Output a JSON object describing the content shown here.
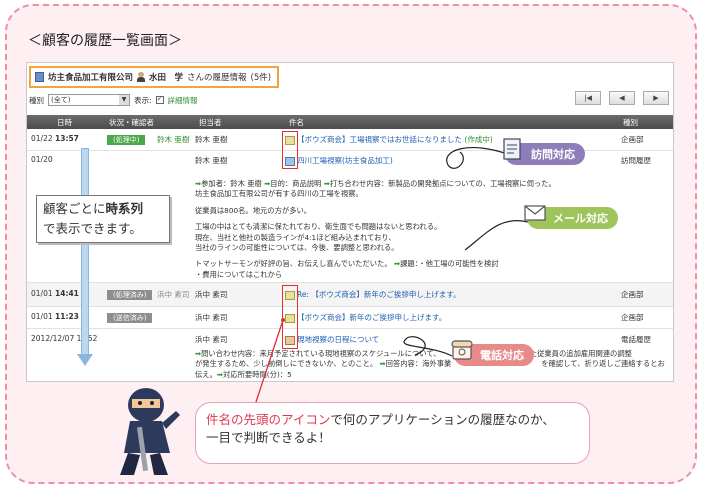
{
  "page_heading": "＜顧客の履歴一覧画面＞",
  "header": {
    "company": "坊主食品加工有限公司",
    "person": "水田　学",
    "suffix": "さんの履歴情報",
    "count": "(5件)"
  },
  "filter": {
    "type_label": "種別",
    "type_value": "(全て)",
    "display_label": "表示:",
    "detail_label": "詳細情報"
  },
  "pager": [
    "|◀",
    "◀",
    "▶"
  ],
  "columns": [
    "日時",
    "状況・確認者",
    "担当者",
    "件名",
    "種別"
  ],
  "rows": [
    {
      "date": "01/22",
      "time": "13:57",
      "status": "(処理中)",
      "confirmer": "鈴木 亜樹",
      "owner": "鈴木 亜樹",
      "subject": "【ボウズ商会】工場視察ではお世話になりました",
      "subject_extra": "(作成中)",
      "kind": "企画部"
    },
    {
      "date": "01/20",
      "time": "",
      "status": "",
      "confirmer": "",
      "owner": "鈴木 亜樹",
      "subject": "四川工場視察",
      "subject_extra": "(坊主食品加工)",
      "kind": "訪問履歴"
    },
    {
      "date": "01/01",
      "time": "14:41",
      "status": "(処理済み)",
      "confirmer": "浜中 素司",
      "owner": "浜中 素司",
      "subject_prefix": "Re:",
      "subject": "【ボウズ商会】新年のご挨拶申し上げます。",
      "subject_extra": "",
      "kind": "企画部"
    },
    {
      "date": "01/01",
      "time": "11:23",
      "status": "(送信済み)",
      "confirmer": "",
      "owner": "浜中 素司",
      "subject": "【ボウズ商会】新年のご挨拶申し上げます。",
      "subject_extra": "",
      "kind": "企画部"
    },
    {
      "date": "2012/12/07",
      "time": "1?:52",
      "status": "",
      "confirmer": "",
      "owner": "浜中 素司",
      "subject": "現地視察の日程について",
      "subject_extra": "",
      "kind": "電話履歴"
    }
  ],
  "visit_detail": [
    "参加者：鈴木 亜樹",
    "目的：商品説明",
    "打ち合わせ内容：新製品の開発拠点についての、工場視察に伺った。",
    "坊主食品加工有限公司が有する四川の工場を視察。",
    "従業員は800名。地元の方が多い。",
    "工場の中はとても清潔に保たれており、衛生面でも問題はないと思われる。",
    "現在、当社と他社の製造ラインが4:1ほど組み込まれており、",
    "当社のラインの可能性については、今後、要調整と思われる。",
    "トマットサーモンが好評の旨、お伝えし喜んでいただいた。",
    "課題：・他工場の可能性を検討",
    "・費用についてはこれから"
  ],
  "phone_detail": [
    "問い合わせ内容：来月予定されている現地視察のスケジュールについて、",
    "に合わせた従業員の追加雇用関連の調整",
    "が発生するため、少し前倒しにできないか、とのこと。",
    "回答内容：海外事業",
    "を確認して、折り返しご連絡するとお",
    "伝え。",
    "対応所要時間(分)：5"
  ],
  "callout": {
    "line1_a": "顧客ごとに",
    "line1_b": "時系列",
    "line2": "で表示できます。"
  },
  "badges": {
    "visit": "訪問対応",
    "mail": "メール対応",
    "phone": "電話対応"
  },
  "speech": {
    "red_a": "件名の先頭の",
    "red_b": "アイコン",
    "text_a": "で何のアプリケーションの履歴なのか、",
    "text_b": "一目で判断できるよ！"
  },
  "colors": {
    "frame_pink": "#ee8fa6",
    "bg_pink": "#fdeff2",
    "header_orange": "#f0a640",
    "visit_purple": "#8e7db8",
    "mail_green": "#9ec45b",
    "phone_pink": "#e88a8a",
    "highlight_red": "#e03030"
  }
}
